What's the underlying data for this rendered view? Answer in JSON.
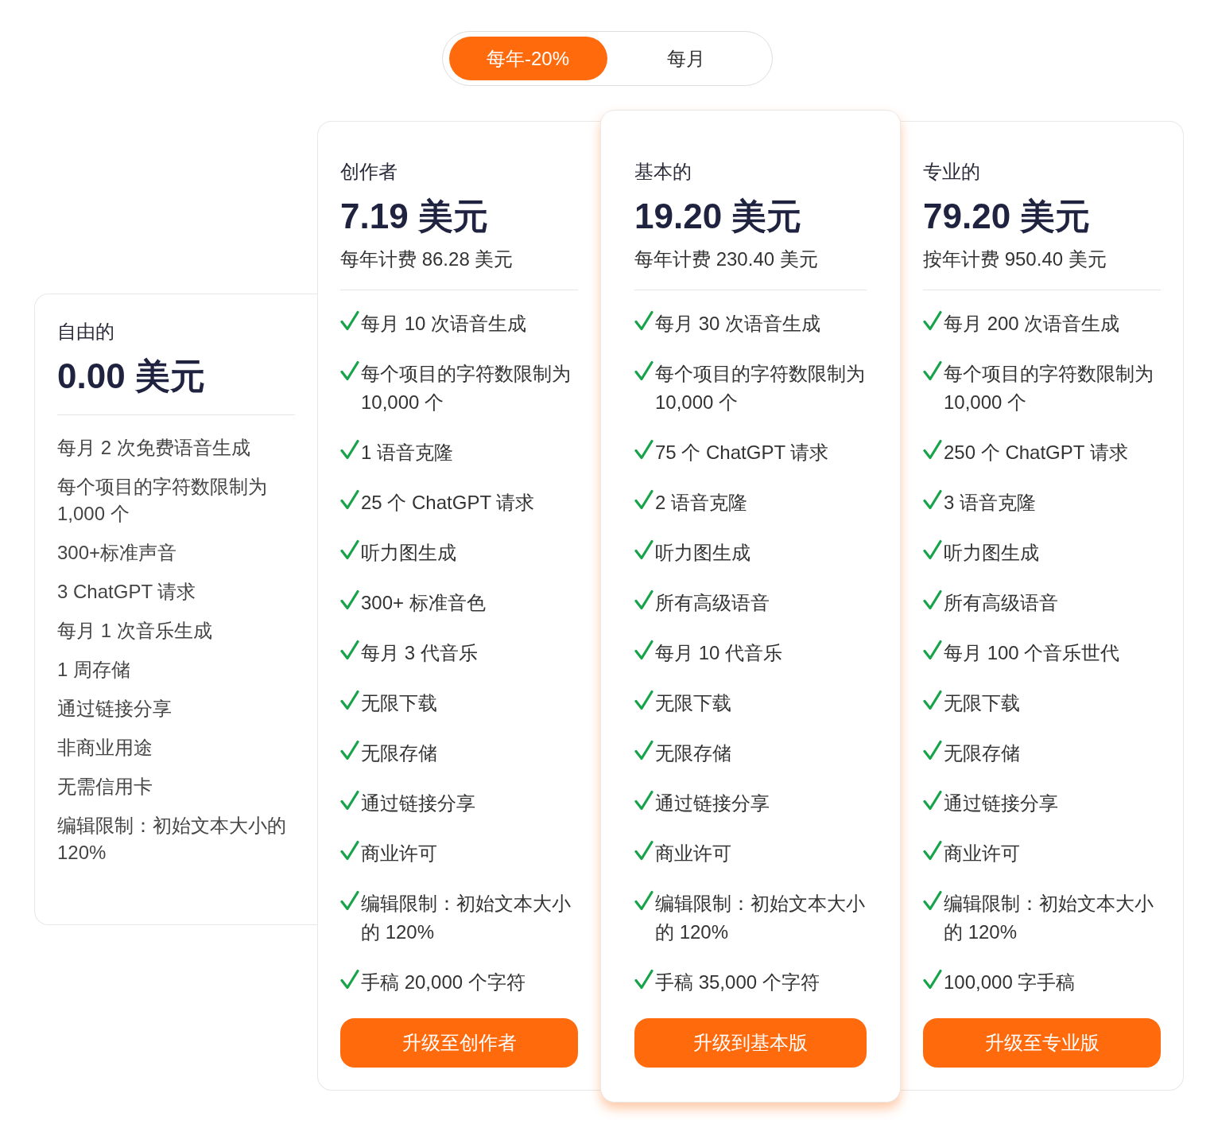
{
  "billing_toggle": [
    {
      "label": "每年-20%",
      "selected": true
    },
    {
      "label": "每月",
      "selected": false
    }
  ],
  "plans": [
    {
      "kind": "free",
      "highlighted": false,
      "name": "自由的",
      "price": "0.00 美元",
      "features": [
        "每月 2 次免费语音生成",
        "每个项目的字符数限制为 1,000 个",
        "300+标准声音",
        "3 ChatGPT 请求",
        "每月 1 次音乐生成",
        "1 周存储",
        "通过链接分享",
        "非商业用途",
        "无需信用卡",
        "编辑限制：初始文本大小的 120%"
      ]
    },
    {
      "kind": "paid",
      "highlighted": false,
      "name": "创作者",
      "price": "7.19 美元",
      "billing": "每年计费 86.28 美元",
      "features": [
        "每月 10 次语音生成",
        "每个项目的字符数限制为 10,000 个",
        "1 语音克隆",
        "25 个 ChatGPT 请求",
        "听力图生成",
        "300+ 标准音色",
        "每月 3 代音乐",
        "无限下载",
        "无限存储",
        "通过链接分享",
        "商业许可",
        "编辑限制：初始文本大小的 120%",
        "手稿 20,000 个字符"
      ],
      "button": "升级至创作者"
    },
    {
      "kind": "paid",
      "highlighted": true,
      "name": "基本的",
      "price": "19.20 美元",
      "billing": "每年计费 230.40 美元",
      "features": [
        "每月 30 次语音生成",
        "每个项目的字符数限制为 10,000 个",
        "75 个 ChatGPT 请求",
        "2 语音克隆",
        "听力图生成",
        "所有高级语音",
        "每月 10 代音乐",
        "无限下载",
        "无限存储",
        "通过链接分享",
        "商业许可",
        "编辑限制：初始文本大小的 120%",
        "手稿 35,000 个字符"
      ],
      "button": "升级到基本版"
    },
    {
      "kind": "paid",
      "highlighted": false,
      "name": "专业的",
      "price": "79.20 美元",
      "billing": "按年计费 950.40 美元",
      "features": [
        "每月 200 次语音生成",
        "每个项目的字符数限制为 10,000 个",
        "250 个 ChatGPT 请求",
        "3 语音克隆",
        "听力图生成",
        "所有高级语音",
        "每月 100 个音乐世代",
        "无限下载",
        "无限存储",
        "通过链接分享",
        "商业许可",
        "编辑限制：初始文本大小的 120%",
        "100,000 字手稿"
      ],
      "button": "升级至专业版"
    }
  ]
}
